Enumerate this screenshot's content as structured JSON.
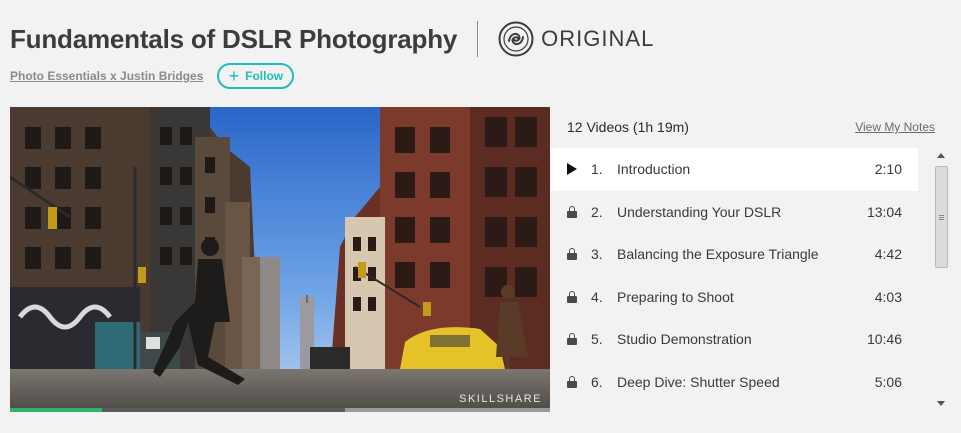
{
  "course": {
    "title": "Fundamentals of DSLR Photography",
    "badge_label": "ORIGINAL",
    "author": "Photo Essentials x Justin Bridges",
    "follow_label": "Follow",
    "follow_icon": "plus-icon"
  },
  "video": {
    "watermark": "SKILLSHARE",
    "progress_fraction": 0.17,
    "buffered_fraction": 0.62
  },
  "playlist": {
    "summary": "12 Videos (1h 19m)",
    "notes_link": "View My Notes",
    "items": [
      {
        "num": "1.",
        "title": "Introduction",
        "duration": "2:10",
        "icon": "play-icon",
        "active": true
      },
      {
        "num": "2.",
        "title": "Understanding Your DSLR",
        "duration": "13:04",
        "icon": "lock-icon",
        "active": false
      },
      {
        "num": "3.",
        "title": "Balancing the Exposure Triangle",
        "duration": "4:42",
        "icon": "lock-icon",
        "active": false
      },
      {
        "num": "4.",
        "title": "Preparing to Shoot",
        "duration": "4:03",
        "icon": "lock-icon",
        "active": false
      },
      {
        "num": "5.",
        "title": "Studio Demonstration",
        "duration": "10:46",
        "icon": "lock-icon",
        "active": false
      },
      {
        "num": "6.",
        "title": "Deep Dive: Shutter Speed",
        "duration": "5:06",
        "icon": "lock-icon",
        "active": false
      }
    ]
  },
  "colors": {
    "accent": "#1fbdb7",
    "progress": "#2fb36b",
    "background": "#f2f2f2"
  }
}
